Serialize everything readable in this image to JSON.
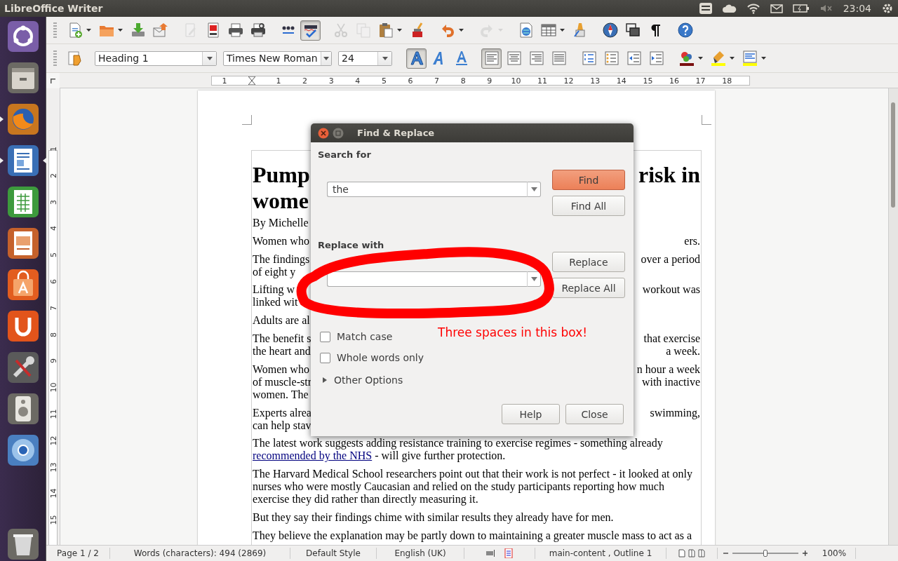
{
  "top_bar": {
    "title": "LibreOffice Writer",
    "clock": "23:04"
  },
  "launcher": [
    {
      "kind": "ubuntu",
      "running": false,
      "active": false
    },
    {
      "kind": "files",
      "running": false,
      "active": false
    },
    {
      "kind": "firefox",
      "running": true,
      "active": false
    },
    {
      "kind": "writer",
      "running": true,
      "active": true
    },
    {
      "kind": "calc",
      "running": false,
      "active": false
    },
    {
      "kind": "impress",
      "running": false,
      "active": false
    },
    {
      "kind": "store",
      "running": false,
      "active": false
    },
    {
      "kind": "ubuntuone",
      "running": false,
      "active": false
    },
    {
      "kind": "settings",
      "running": false,
      "active": false
    },
    {
      "kind": "speaker",
      "running": false,
      "active": false
    },
    {
      "kind": "chromium",
      "running": false,
      "active": false
    },
    {
      "kind": "trash",
      "running": false,
      "active": false
    }
  ],
  "standard_toolbar": [
    {
      "kind": "new",
      "menu": true,
      "on": false,
      "disabled": false
    },
    {
      "kind": "open",
      "menu": true,
      "on": false,
      "disabled": false
    },
    {
      "kind": "save",
      "on": false,
      "disabled": false
    },
    {
      "kind": "email",
      "on": false,
      "disabled": false
    },
    {
      "kind": "edit",
      "on": false,
      "disabled": true
    },
    {
      "kind": "pdf",
      "on": false,
      "disabled": false
    },
    {
      "kind": "print",
      "on": false,
      "disabled": false
    },
    {
      "kind": "preview",
      "on": false,
      "disabled": false
    },
    {
      "kind": "spell",
      "disabled": false
    },
    {
      "kind": "autospell",
      "on": true,
      "disabled": false
    },
    {
      "kind": "cut",
      "on": false,
      "disabled": true
    },
    {
      "kind": "copy",
      "on": false,
      "disabled": true
    },
    {
      "kind": "paste",
      "menu": true,
      "on": false,
      "disabled": false
    },
    {
      "kind": "clone",
      "on": false,
      "disabled": false
    },
    {
      "kind": "undo",
      "menu": true,
      "on": false,
      "disabled": false
    },
    {
      "kind": "redo",
      "menu": true,
      "on": false,
      "disabled": true
    },
    {
      "kind": "hyperlink",
      "on": false,
      "disabled": false
    },
    {
      "kind": "table",
      "menu": true,
      "on": false,
      "disabled": false
    },
    {
      "kind": "draw",
      "on": false,
      "disabled": false
    },
    {
      "kind": "navigator",
      "on": false,
      "disabled": false
    },
    {
      "kind": "gallery",
      "on": false,
      "disabled": false
    },
    {
      "kind": "pilcrow",
      "on": false,
      "disabled": false
    },
    {
      "kind": "help",
      "on": false,
      "disabled": false
    }
  ],
  "formatting_toolbar": {
    "paragraph_style": "Heading 1",
    "font_name": "Times New Roman",
    "font_size": "24",
    "buttons": [
      {
        "kind": "bold",
        "on": true,
        "disabled": false
      },
      {
        "kind": "italic",
        "on": false,
        "disabled": false
      },
      {
        "kind": "underline",
        "on": false,
        "disabled": false
      },
      {
        "kind": "align-left",
        "on": true,
        "disabled": false
      },
      {
        "kind": "align-center",
        "on": false,
        "disabled": false
      },
      {
        "kind": "align-right",
        "on": false,
        "disabled": false
      },
      {
        "kind": "justify",
        "on": false,
        "disabled": false
      },
      {
        "kind": "numbering",
        "on": false,
        "disabled": false
      },
      {
        "kind": "bullets",
        "on": false,
        "disabled": false
      },
      {
        "kind": "outdent",
        "on": false,
        "disabled": false
      },
      {
        "kind": "indent",
        "on": false,
        "disabled": false
      },
      {
        "kind": "font-color",
        "menu": true,
        "on": false,
        "disabled": false
      },
      {
        "kind": "highlight",
        "menu": true,
        "on": false,
        "disabled": false
      },
      {
        "kind": "background",
        "menu": true,
        "on": false,
        "disabled": false
      }
    ]
  },
  "horizontal_ruler": [
    "1",
    "1",
    "2",
    "3",
    "4",
    "5",
    "6",
    "7",
    "8",
    "9",
    "10",
    "11",
    "12",
    "13",
    "14",
    "15",
    "16",
    "17",
    "18"
  ],
  "vertical_ruler": [
    "1",
    "2",
    "3",
    "4",
    "5",
    "6",
    "7",
    "8",
    "9",
    "10",
    "11",
    "12",
    "13",
    "14",
    "15"
  ],
  "document": {
    "blocks": [
      {
        "kind": "heading",
        "lines": [
          {
            "left": "Pump",
            "right": "risk in"
          },
          {
            "left": "wome"
          }
        ]
      },
      {
        "kind": "split",
        "lines": [
          {
            "left": "By Michelle"
          }
        ]
      },
      {
        "kind": "split",
        "lines": [
          {
            "left": "Women who",
            "right": "ers."
          }
        ]
      },
      {
        "kind": "split",
        "lines": [
          {
            "left": "The findings",
            "right": "over a period"
          },
          {
            "left": "of eight y"
          }
        ]
      },
      {
        "kind": "split",
        "lines": [
          {
            "left": "Lifting w",
            "right": "workout was"
          },
          {
            "left": "linked wit"
          }
        ]
      },
      {
        "kind": "split",
        "lines": [
          {
            "left": "Adults are al"
          }
        ]
      },
      {
        "kind": "split",
        "lines": [
          {
            "left": "The benefit s",
            "right": "that exercise"
          },
          {
            "left": "the heart and",
            "right": "a week."
          }
        ]
      },
      {
        "kind": "split",
        "lines": [
          {
            "left": "Women who",
            "right": "n hour a week"
          },
          {
            "left": "of muscle-str",
            "right": "with inactive"
          },
          {
            "left": "women. The"
          }
        ]
      },
      {
        "kind": "split",
        "lines": [
          {
            "left": "Experts alrea",
            "right": "swimming,"
          },
          {
            "left": "can help stav"
          }
        ]
      },
      {
        "kind": "text",
        "runs": [
          {
            "text": "The latest work suggests adding resistance training to exercise regimes - something already ",
            "link": false
          },
          {
            "text": "recommended by the NHS",
            "link": true
          },
          {
            "text": " - will give further protection.",
            "link": false
          }
        ]
      },
      {
        "kind": "text",
        "runs": [
          {
            "text": "The Harvard Medical School researchers point out that their work is not perfect - it looked at only nurses who were mostly Caucasian and relied on the study participants reporting how much exercise they did rather than directly measuring it.",
            "link": false
          }
        ]
      },
      {
        "kind": "text",
        "runs": [
          {
            "text": "But they say their findings chime with similar results they already have for men.",
            "link": false
          }
        ]
      },
      {
        "kind": "text",
        "runs": [
          {
            "text": "They believe the explanation may be partly down to maintaining a greater muscle mass to act as a",
            "link": false
          }
        ]
      }
    ]
  },
  "dialog": {
    "title": "Find & Replace",
    "search_label": "Search for",
    "search_value": "the",
    "replace_label": "Replace with",
    "search_buttons": [
      {
        "label": "Find",
        "default": true
      },
      {
        "label": "Find All",
        "default": false
      }
    ],
    "replace_buttons": [
      {
        "label": "Replace",
        "default": false
      },
      {
        "label": "Replace All",
        "default": false
      }
    ],
    "options": [
      {
        "label": "Match case",
        "checked": false
      },
      {
        "label": "Whole words only",
        "checked": false
      }
    ],
    "other_options": {
      "label": "Other Options",
      "expanded": false
    },
    "footer_buttons": [
      {
        "label": "Help",
        "default": false
      },
      {
        "label": "Close",
        "default": false
      }
    ]
  },
  "annotation": {
    "text": "Three spaces in this box!"
  },
  "status_bar": {
    "page": "Page 1 / 2",
    "words": "Words (characters): 494 (2869)",
    "page_style": "Default Style",
    "language": "English (UK)",
    "section": "main-content , Outline 1",
    "zoom": "100%",
    "zoom_slider": {
      "level": 0.5
    }
  }
}
